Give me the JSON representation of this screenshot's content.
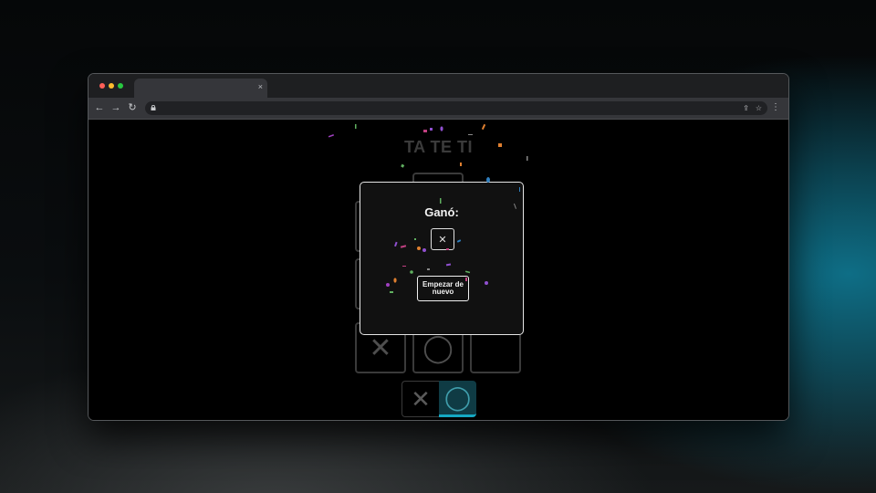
{
  "browser": {
    "tab_close_glyph": "×",
    "back_glyph": "←",
    "forward_glyph": "→",
    "reload_glyph": "↻",
    "share_glyph": "⇪",
    "bookmark_glyph": "☆",
    "menu_glyph": "⋮"
  },
  "game": {
    "title": "TA TE TI",
    "board": [
      "",
      "",
      "",
      "",
      "",
      "",
      "✕",
      "◯",
      ""
    ],
    "turn_x": "✕",
    "turn_o": "◯",
    "active_turn": "O"
  },
  "modal": {
    "title": "Ganó:",
    "winner": "✕",
    "restart_label": "Empezar de nuevo"
  },
  "colors": {
    "accent": "#15a8c2",
    "traffic_red": "#fe5f57",
    "traffic_yellow": "#febc2e",
    "traffic_green": "#28c840"
  },
  "confetti_colors": [
    "#a040c0",
    "#60b060",
    "#e08030",
    "#3080c0",
    "#c04080",
    "#9050d0"
  ]
}
